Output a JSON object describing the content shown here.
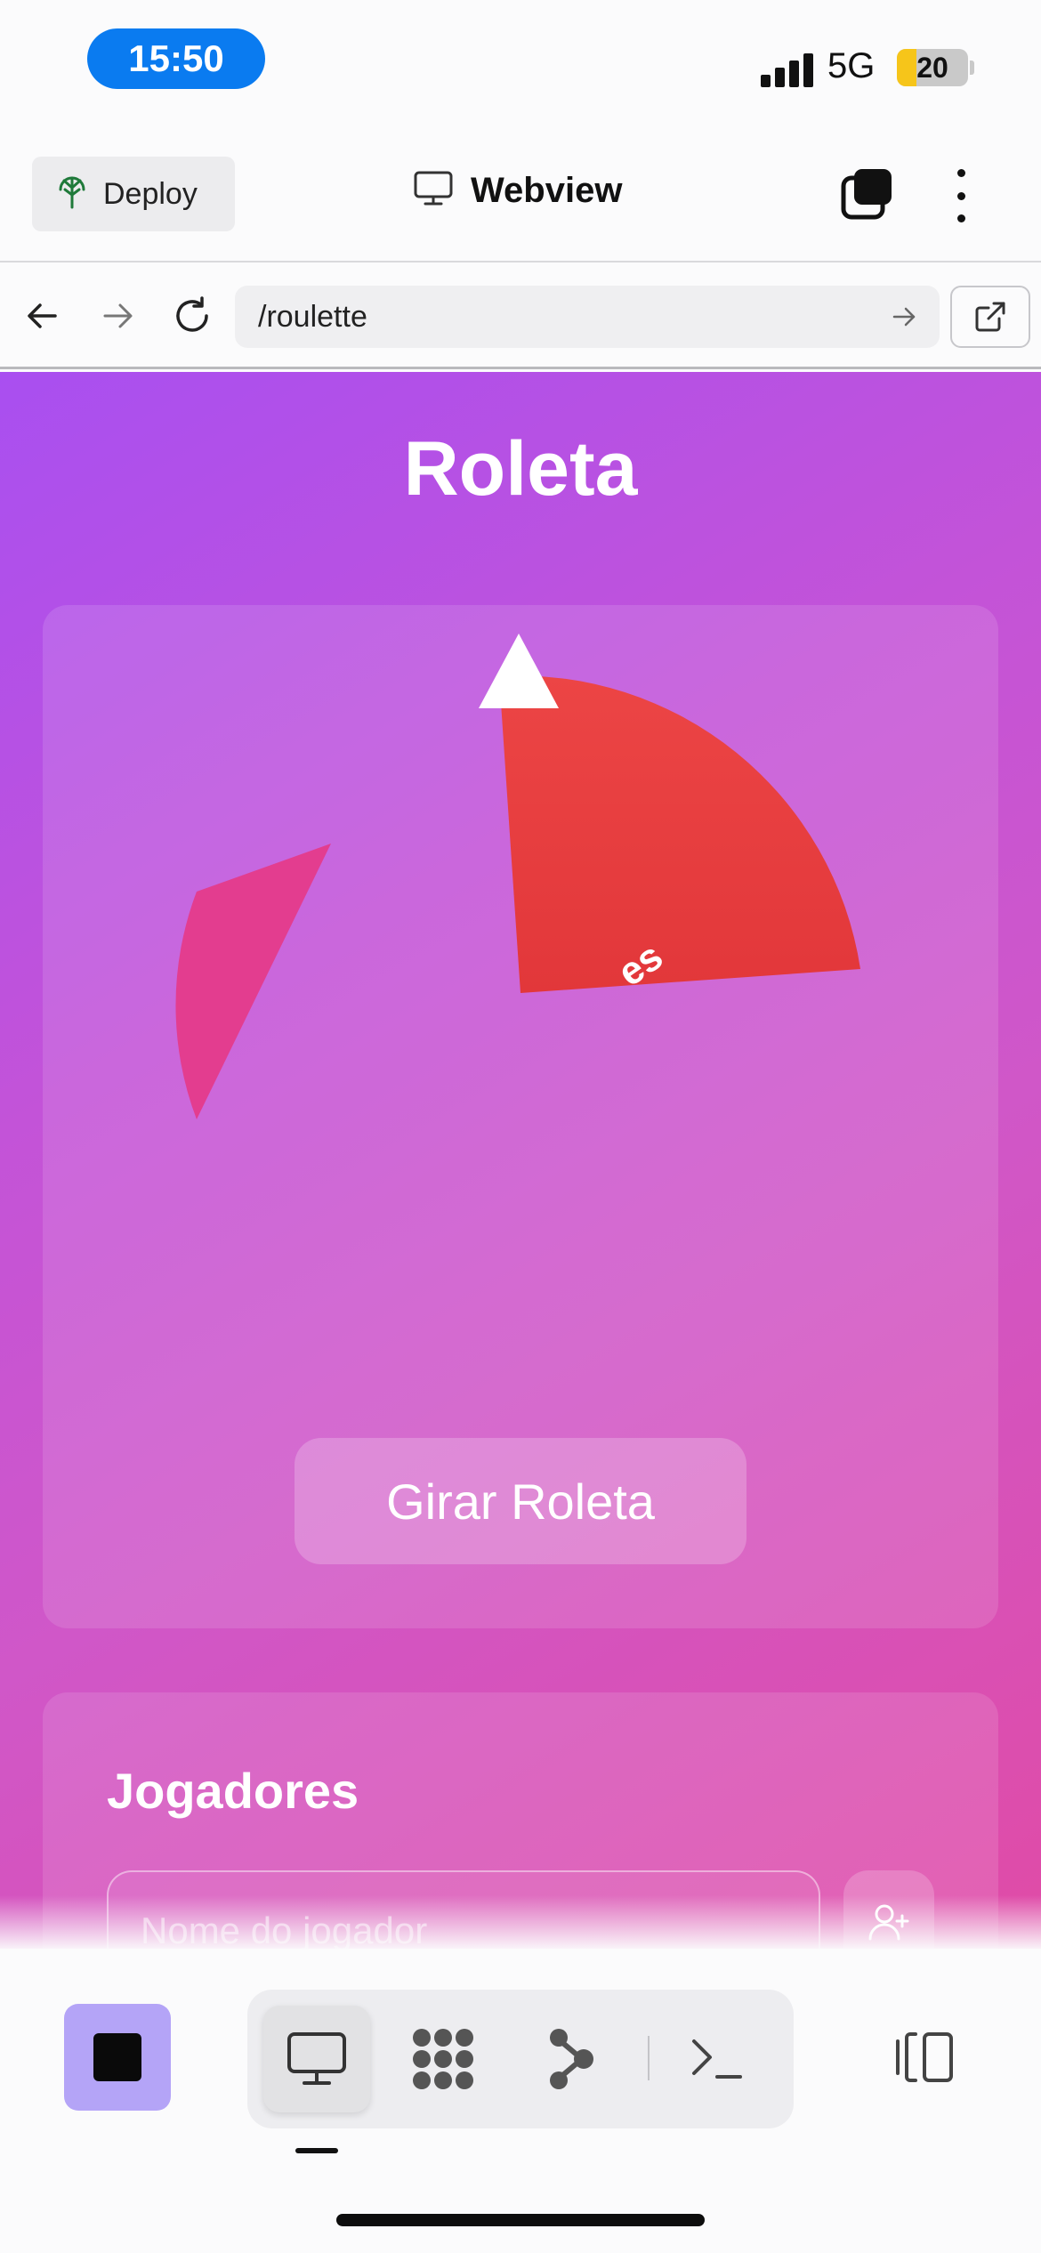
{
  "status_bar": {
    "time": "15:50",
    "network": "5G",
    "battery": "20",
    "battery_level": 0.2,
    "time_pill_color": "#0a7bf0",
    "battery_fill_color": "#f6c51a"
  },
  "app_bar": {
    "deploy_label": "Deploy",
    "title": "Webview",
    "icons": [
      "deploy-icon",
      "monitor-icon",
      "tabs-icon",
      "more-vertical-icon"
    ]
  },
  "url_bar": {
    "url": "/roulette",
    "icons": [
      "back-arrow-icon",
      "forward-arrow-icon",
      "reload-icon",
      "go-arrow-icon",
      "external-link-icon"
    ]
  },
  "page": {
    "title": "Roleta",
    "wheel": {
      "segment_label": "es",
      "segment_colors": [
        "#e83b3b",
        "#e23c8e"
      ],
      "pointer_color": "#ffffff"
    },
    "spin_button": "Girar Roleta",
    "players": {
      "title": "Jogadores",
      "input_placeholder": "Nome do jogador",
      "input_value": "",
      "add_icon": "user-plus-icon"
    },
    "gradient_colors": [
      "#a94ff0",
      "#e04ba6"
    ]
  },
  "bottom_toolbar": {
    "stop_color": "#b4a4f7",
    "tools": [
      "webview-tool-icon",
      "shell-grid-icon",
      "git-branch-icon",
      "terminal-icon"
    ],
    "active_tool": "webview-tool-icon",
    "panel_icon": "panel-toggle-icon"
  }
}
